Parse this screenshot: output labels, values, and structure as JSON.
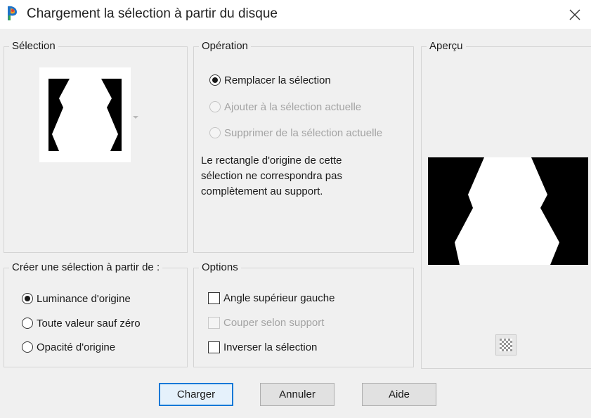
{
  "window": {
    "title": "Chargement la sélection à partir du disque",
    "icons": {
      "app": "paint-palette-icon",
      "close": "close-icon"
    }
  },
  "selection_group": {
    "label": "Sélection",
    "thumbnail_icon": "selection-mask-thumbnail",
    "dropdown_icon": "chevron-down-icon"
  },
  "operation_group": {
    "label": "Opération",
    "options": [
      {
        "label": "Remplacer la sélection",
        "selected": true,
        "enabled": true
      },
      {
        "label": "Ajouter à la sélection actuelle",
        "selected": false,
        "enabled": false
      },
      {
        "label": "Supprimer de la sélection actuelle",
        "selected": false,
        "enabled": false
      }
    ],
    "info": "Le rectangle d'origine de cette\nsélection ne correspondra pas\ncomplètement au support."
  },
  "preview_group": {
    "label": "Aperçu",
    "transparency_icon": "checkerboard-icon"
  },
  "create_group": {
    "label": "Créer une sélection à partir de :",
    "options": [
      {
        "label": "Luminance d'origine",
        "selected": true
      },
      {
        "label": "Toute valeur sauf zéro",
        "selected": false
      },
      {
        "label": "Opacité d'origine",
        "selected": false
      }
    ]
  },
  "options_group": {
    "label": "Options",
    "checkboxes": [
      {
        "label": "Angle supérieur gauche",
        "checked": false,
        "enabled": true
      },
      {
        "label": "Couper selon support",
        "checked": false,
        "enabled": false
      },
      {
        "label": "Inverser la sélection",
        "checked": false,
        "enabled": true
      }
    ]
  },
  "buttons": {
    "load": "Charger",
    "cancel": "Annuler",
    "help": "Aide"
  },
  "colors": {
    "accent": "#0078d7",
    "dialog_bg": "#f0f0f0",
    "group_border": "#d4d4d4",
    "disabled_text": "#a3a3a3"
  }
}
